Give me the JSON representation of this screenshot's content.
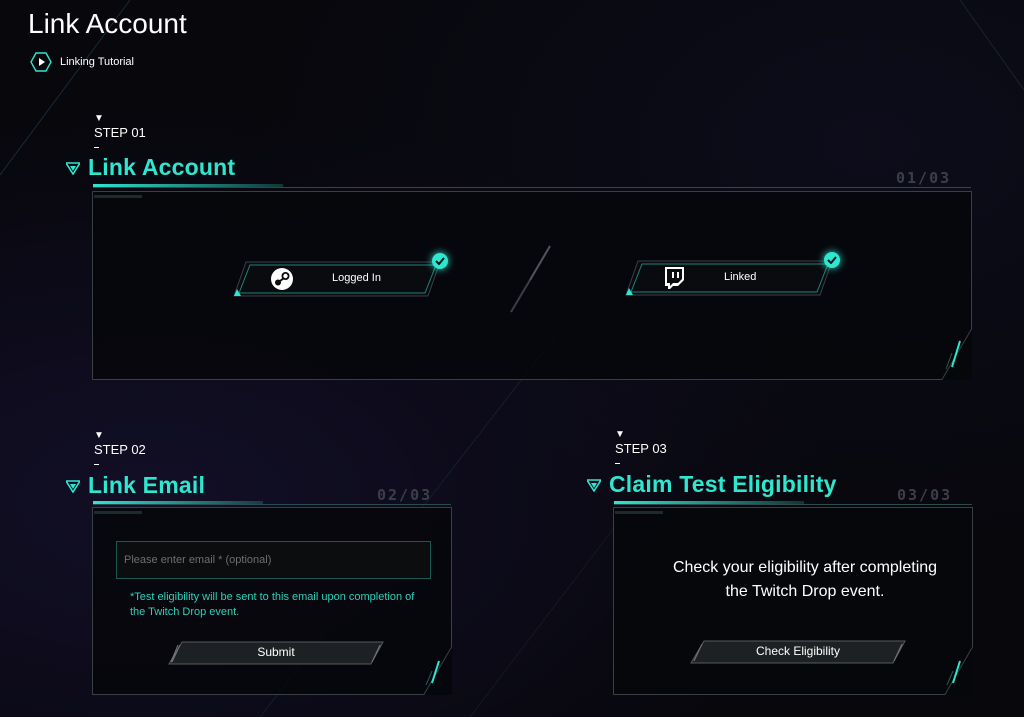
{
  "page": {
    "title": "Link Account"
  },
  "tutorial": {
    "label": "Linking Tutorial"
  },
  "steps": [
    {
      "number": "STEP 01",
      "title": "Link Account",
      "counter": "01/03"
    },
    {
      "number": "STEP 02",
      "title": "Link Email",
      "counter": "02/03"
    },
    {
      "number": "STEP 03",
      "title": "Claim Test Eligibility",
      "counter": "03/03"
    }
  ],
  "accounts": [
    {
      "name": "steam",
      "icon": "steam-icon",
      "status": "Logged In"
    },
    {
      "name": "twitch",
      "icon": "twitch-icon",
      "status": "Linked"
    }
  ],
  "email": {
    "placeholder": "Please enter email * (optional)",
    "value": "",
    "note": "*Test eligibility will be sent to this email upon completion of the Twitch Drop event.",
    "submit_label": "Submit"
  },
  "eligibility": {
    "message": "Check your eligibility after completing the Twitch Drop event.",
    "button_label": "Check Eligibility"
  },
  "colors": {
    "accent": "#2fe6cf",
    "background": "#07070c",
    "frame": "#3a3f45"
  }
}
